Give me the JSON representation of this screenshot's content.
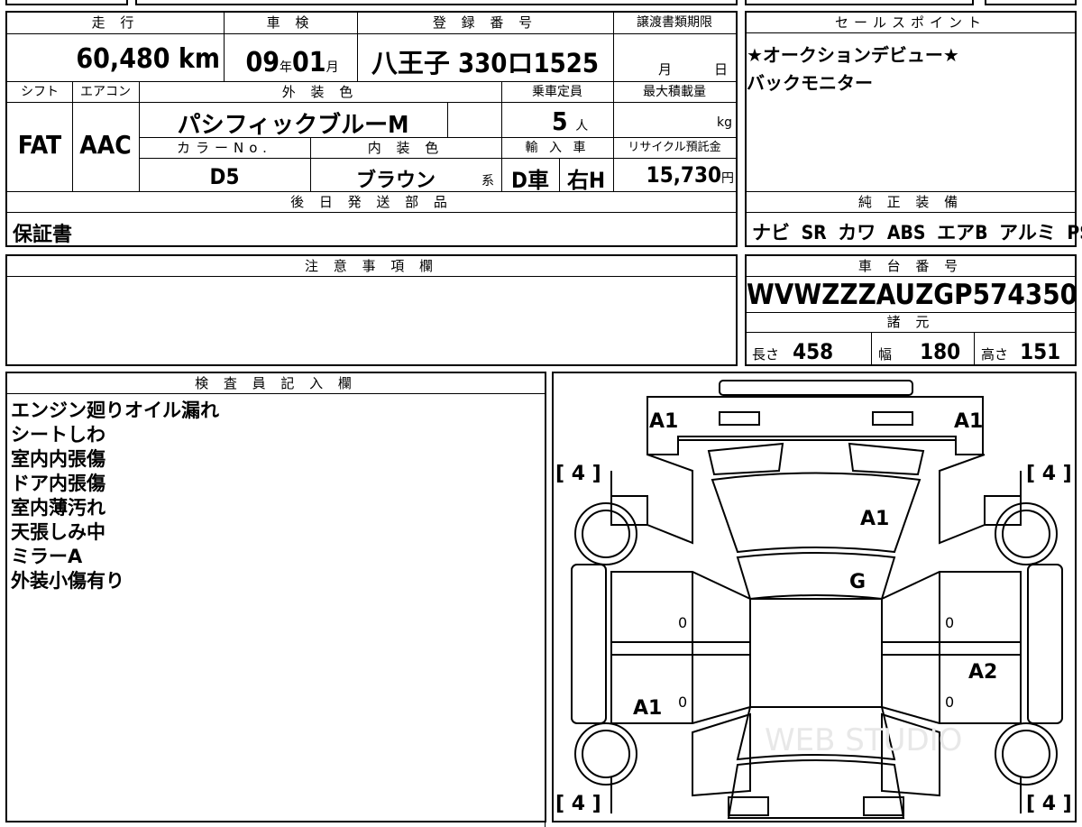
{
  "main": {
    "headers": {
      "mileage": "走 行",
      "shaken": "車 検",
      "reg_no": "登 録 番 号",
      "transfer": "譲渡書類期限"
    },
    "mileage": "60,480",
    "mileage_unit": "km",
    "shaken_year": "09",
    "year_unit": "年",
    "shaken_month": "01",
    "month_unit": "月",
    "reg_no": "八王子 330ロ1525",
    "transfer_month": "月",
    "transfer_day": "日",
    "row2_headers": {
      "shift": "シフト",
      "aircon": "エアコン",
      "ext_color": "外 装 色",
      "capacity": "乗車定員",
      "max_load": "最大積載量"
    },
    "shift": "FAT",
    "aircon": "AAC",
    "ext_color": "パシフィックブルーM",
    "capacity": "5",
    "capacity_unit": "人",
    "max_load_unit": "kg",
    "row3_headers": {
      "color_no": "カラーNo.",
      "int_color": "内 装 色",
      "import": "輸 入 車",
      "recycle": "リサイクル預託金"
    },
    "color_no": "D5",
    "int_color": "ブラウン",
    "int_color_suffix": "系",
    "import_car": "D車",
    "handle": "右H",
    "recycle": "15,730",
    "recycle_unit": "円",
    "parts_header": "後 日 発 送 部 品",
    "parts": "保証書"
  },
  "sales": {
    "header": "セールスポイント",
    "lines": [
      "★オークションデビュー★",
      "バックモニター"
    ]
  },
  "equipment": {
    "header": "純 正 装 備",
    "items": "ナビ SR カワ ABS エアB アルミ PS PW"
  },
  "caution": {
    "header": "注 意 事 項 欄"
  },
  "vin": {
    "header": "車 台 番 号",
    "value": "WVWZZZAUZGP574350"
  },
  "specs": {
    "header": "諸 元",
    "length_label": "長さ",
    "length": "458",
    "width_label": "幅",
    "width": "180",
    "height_label": "高さ",
    "height": "151"
  },
  "inspector": {
    "header": "検 査 員 記 入 欄",
    "lines": [
      "エンジン廻りオイル漏れ",
      "シートしわ",
      "室内内張傷",
      "ドア内張傷",
      "室内薄汚れ",
      "天張しみ中",
      "ミラーA",
      "外装小傷有り"
    ]
  },
  "diagram": {
    "marks": {
      "front_left": "A1",
      "front_right": "A1",
      "roof": "A1",
      "glass": "G",
      "rear_right_door": "A2",
      "rear_left_door": "A1"
    },
    "tires": {
      "fl": "[ 4 ]",
      "fr": "[ 4 ]",
      "rl": "[ 4 ]",
      "rr": "[ 4 ]"
    },
    "zero": "0"
  },
  "watermark": "WEB STUDIO"
}
